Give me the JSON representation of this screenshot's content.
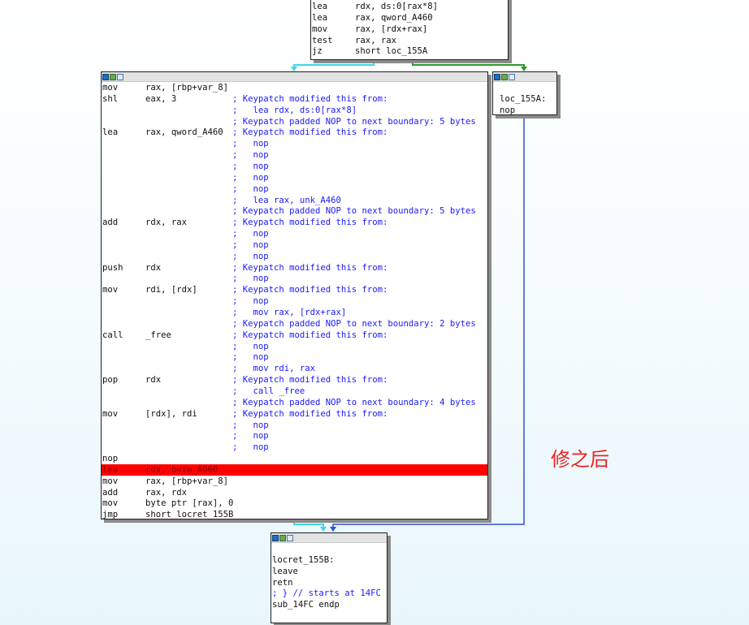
{
  "annotation": "修之后",
  "top_block": {
    "lines": [
      {
        "mn": "lea",
        "op": "rdx, ds:0[rax*8]"
      },
      {
        "mn": "lea",
        "op": "rax, qword_A460"
      },
      {
        "mn": "mov",
        "op": "rax, [rdx+rax]"
      },
      {
        "mn": "test",
        "op": "rax, rax"
      },
      {
        "mn": "jz",
        "op": "short loc_155A"
      }
    ]
  },
  "main_block": {
    "lines": [
      {
        "mn": "mov",
        "op": "rax, [rbp+var_8]",
        "cm": ""
      },
      {
        "mn": "shl",
        "op": "eax, 3",
        "cm": "; Keypatch modified this from:"
      },
      {
        "mn": "",
        "op": "",
        "cm": ";   lea rdx, ds:0[rax*8]"
      },
      {
        "mn": "",
        "op": "",
        "cm": "; Keypatch padded NOP to next boundary: 5 bytes"
      },
      {
        "mn": "lea",
        "op": "rax, qword_A460",
        "cm": "; Keypatch modified this from:"
      },
      {
        "mn": "",
        "op": "",
        "cm": ";   nop"
      },
      {
        "mn": "",
        "op": "",
        "cm": ";   nop"
      },
      {
        "mn": "",
        "op": "",
        "cm": ";   nop"
      },
      {
        "mn": "",
        "op": "",
        "cm": ";   nop"
      },
      {
        "mn": "",
        "op": "",
        "cm": ";   nop"
      },
      {
        "mn": "",
        "op": "",
        "cm": ";   lea rax, unk_A460"
      },
      {
        "mn": "",
        "op": "",
        "cm": "; Keypatch padded NOP to next boundary: 5 bytes"
      },
      {
        "mn": "add",
        "op": "rdx, rax",
        "cm": "; Keypatch modified this from:"
      },
      {
        "mn": "",
        "op": "",
        "cm": ";   nop"
      },
      {
        "mn": "",
        "op": "",
        "cm": ";   nop"
      },
      {
        "mn": "",
        "op": "",
        "cm": ";   nop"
      },
      {
        "mn": "push",
        "op": "rdx",
        "cm": "; Keypatch modified this from:"
      },
      {
        "mn": "",
        "op": "",
        "cm": ";   nop"
      },
      {
        "mn": "mov",
        "op": "rdi, [rdx]",
        "cm": "; Keypatch modified this from:"
      },
      {
        "mn": "",
        "op": "",
        "cm": ";   nop"
      },
      {
        "mn": "",
        "op": "",
        "cm": ";   mov rax, [rdx+rax]"
      },
      {
        "mn": "",
        "op": "",
        "cm": "; Keypatch padded NOP to next boundary: 2 bytes"
      },
      {
        "mn": "call",
        "op": "_free",
        "cm": "; Keypatch modified this from:"
      },
      {
        "mn": "",
        "op": "",
        "cm": ";   nop"
      },
      {
        "mn": "",
        "op": "",
        "cm": ";   nop"
      },
      {
        "mn": "",
        "op": "",
        "cm": ";   mov rdi, rax"
      },
      {
        "mn": "pop",
        "op": "rdx",
        "cm": "; Keypatch modified this from:"
      },
      {
        "mn": "",
        "op": "",
        "cm": ";   call _free"
      },
      {
        "mn": "",
        "op": "",
        "cm": "; Keypatch padded NOP to next boundary: 4 bytes"
      },
      {
        "mn": "mov",
        "op": "[rdx], rdi",
        "cm": "; Keypatch modified this from:"
      },
      {
        "mn": "",
        "op": "",
        "cm": ";   nop"
      },
      {
        "mn": "",
        "op": "",
        "cm": ";   nop"
      },
      {
        "mn": "",
        "op": "",
        "cm": ";   nop"
      },
      {
        "mn": "nop",
        "op": "",
        "cm": ""
      },
      {
        "mn": "lea",
        "op": "rdx, byte_A060",
        "cm": "",
        "highlight": true
      },
      {
        "mn": "mov",
        "op": "rax, [rbp+var_8]",
        "cm": ""
      },
      {
        "mn": "add",
        "op": "rax, rdx",
        "cm": ""
      },
      {
        "mn": "mov",
        "op": "byte ptr [rax], 0",
        "cm": ""
      },
      {
        "mn": "jmp",
        "op": "short locret_155B",
        "cm": ""
      }
    ]
  },
  "loc_block": {
    "lines": [
      "",
      "loc_155A:",
      "nop"
    ]
  },
  "ret_block": {
    "lines": [
      "",
      "locret_155B:",
      "leave",
      "retn",
      "; } // starts at 14FC",
      "sub_14FC endp"
    ]
  },
  "colors": {
    "edge_cyan": "#3fd6ea",
    "edge_green": "#2a9a2a",
    "edge_blue": "#2f4fe0",
    "highlight_red": "#ff0000",
    "comment_blue": "#1a1aff"
  }
}
